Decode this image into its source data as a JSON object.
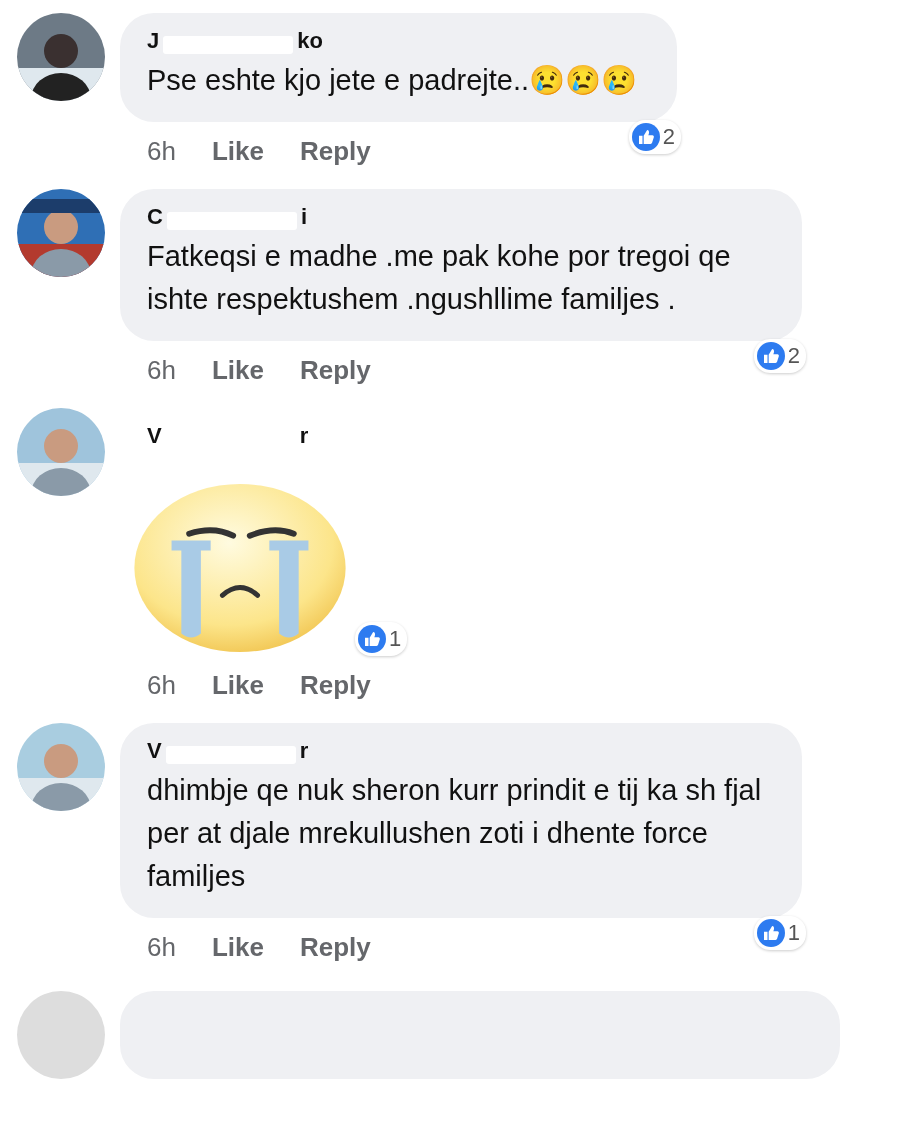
{
  "comments": [
    {
      "kind": "text",
      "name_parts": [
        "J",
        "ko"
      ],
      "text": "Pse eshte kjo jete e padrejte..😢😢😢",
      "time": "6h",
      "actions": [
        "Like",
        "Reply"
      ],
      "reaction_count": "2"
    },
    {
      "kind": "text",
      "name_parts": [
        "C",
        "i"
      ],
      "text": "Fatkeqsi e madhe .me pak kohe por tregoi qe ishte  respektushem .ngushllime familjes .",
      "time": "6h",
      "actions": [
        "Like",
        "Reply"
      ],
      "reaction_count": "2"
    },
    {
      "kind": "sticker",
      "name_parts": [
        "V",
        "r"
      ],
      "time": "6h",
      "actions": [
        "Like",
        "Reply"
      ],
      "reaction_count": "1"
    },
    {
      "kind": "text",
      "name_parts": [
        "V",
        "r"
      ],
      "text": "dhimbje qe nuk sheron kurr prindit e tij ka sh fjal per at djale mrekullushen zoti i dhente force familjes",
      "time": "6h",
      "actions": [
        "Like",
        "Reply"
      ],
      "reaction_count": "1"
    }
  ]
}
